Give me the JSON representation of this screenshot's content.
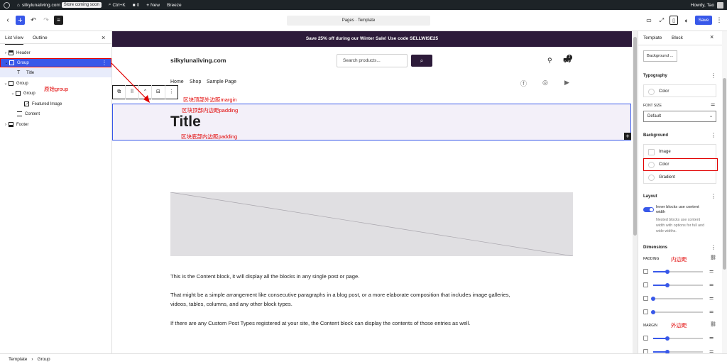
{
  "adminbar": {
    "site_name": "silkylunaliving.com",
    "store_badge": "Store coming soon",
    "shortcut": "Ctrl+K",
    "comments_count": "0",
    "new_label": "New",
    "plugin": "Breeze",
    "greeting": "Howdy, Tao"
  },
  "topbar": {
    "command_label": "Pages · Template",
    "save_label": "Save"
  },
  "left_panel": {
    "tabs": [
      "List View",
      "Outline"
    ],
    "close": "×",
    "rows": [
      {
        "label": "Header"
      },
      {
        "label": "Group"
      },
      {
        "label": "Title"
      },
      {
        "label": "Group"
      },
      {
        "label": "Group"
      },
      {
        "label": "Featured Image"
      },
      {
        "label": "Content"
      },
      {
        "label": "Footer"
      }
    ]
  },
  "canvas": {
    "promo": "Save 25% off during our Winter Sale! Use code SELLWISE25",
    "site_title": "silkylunaliving.com",
    "search_placeholder": "Search products...",
    "cart_count": "2",
    "nav": [
      "Home",
      "Shop",
      "Sample Page"
    ],
    "title": "Title",
    "paragraphs": [
      "This is the Content block, it will display all the blocks in any single post or page.",
      "That might be a simple arrangement like consecutive paragraphs in a blog post, or a more elaborate composition that includes image galleries,",
      "videos, tables, columns, and any other block types.",
      "If there are any Custom Post Types registered at your site, the Content block can display the contents of those entries as well."
    ]
  },
  "annotations": {
    "original_group": "原始group",
    "top_margin": "区块顶部外边距margin",
    "top_padding": "区块顶部内边距padding",
    "bottom_padding": "区块底部内边距padding",
    "padding_note": "内边距",
    "margin_note": "外边距",
    "accent": "#e10000"
  },
  "right_panel": {
    "tabs": [
      "Template",
      "Block"
    ],
    "close": "×",
    "background_button": "Background ...",
    "typography": "Typography",
    "color": "Color",
    "font_size_label": "FONT SIZE",
    "font_size_value": "Default",
    "background": "Background",
    "bg_options": [
      "Image",
      "Color",
      "Gradient"
    ],
    "layout": "Layout",
    "layout_toggle": "Inner blocks use content width",
    "layout_help": [
      "Nested blocks use content",
      "width with options for full and",
      "wide widths."
    ],
    "dimensions": "Dimensions",
    "padding_label": "PADDING",
    "margin_label": "MARGIN",
    "padding_levels": [
      0.28,
      0.28,
      0.0,
      0.0
    ],
    "margin_levels": [
      0.28,
      0.28
    ]
  },
  "footer": {
    "crumbs": [
      "Template",
      "Group"
    ]
  },
  "colors": {
    "accent_blue": "#3858e9",
    "promo_bg": "#2d1b3a",
    "selection_bg": "#f3f0f9"
  }
}
